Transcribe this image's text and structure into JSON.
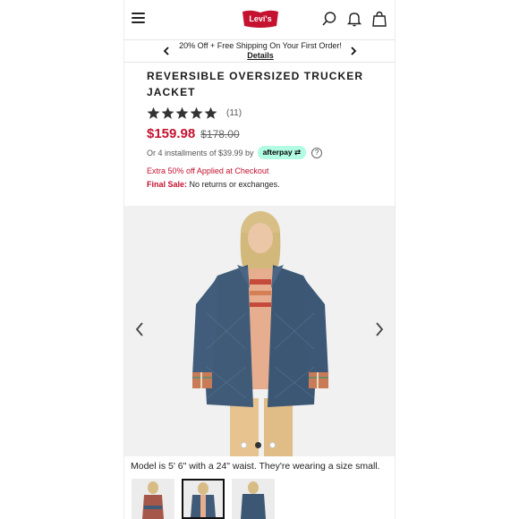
{
  "header": {
    "logo_text": "Levi's",
    "brand_color": "#c41230",
    "icons": [
      "hamburger-menu-icon",
      "search-icon",
      "bell-icon",
      "shopping-bag-icon"
    ]
  },
  "promo": {
    "text": "20% Off + Free Shipping On Your First Order!",
    "link": "Details"
  },
  "product": {
    "title": "REVERSIBLE OVERSIZED TRUCKER JACKET",
    "rating": 5,
    "review_count": "(11)",
    "sale_price": "$159.98",
    "original_price": "$178.00",
    "installments_text": "Or 4 installments of $39.99 by",
    "afterpay_label": "afterpay",
    "help_label": "?",
    "extra_discount": "Extra 50% off Applied at Checkout",
    "final_sale_label": "Final Sale:",
    "final_sale_text": "No returns or exchanges."
  },
  "gallery": {
    "dots": 3,
    "active_dot": 2,
    "model_note": "Model is 5' 6\" with a 24\" waist. They're wearing a size small.",
    "thumbnails": 3,
    "selected_thumbnail": 2
  },
  "colors": {
    "sale_red": "#c41230",
    "afterpay_mint": "#b2fce4",
    "denim": "#3f5b78"
  }
}
